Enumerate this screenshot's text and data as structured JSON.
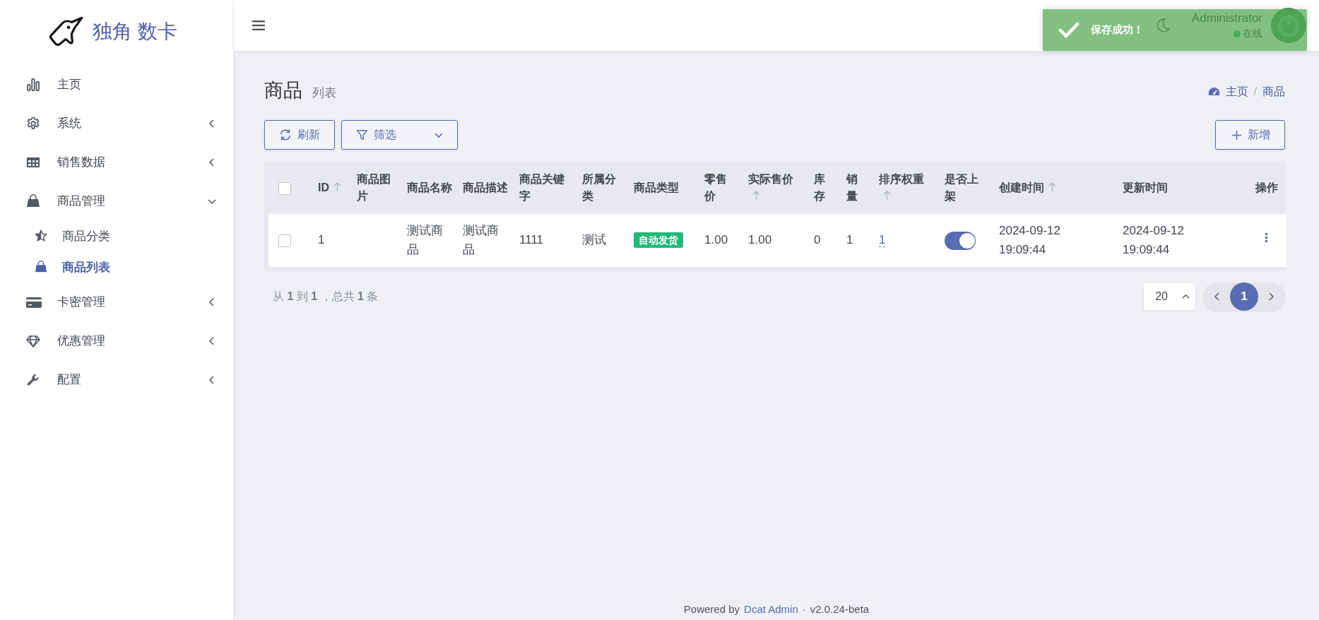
{
  "sidebar": {
    "logo_text": "独角 数卡",
    "items": [
      {
        "label": "主页",
        "kind": "link"
      },
      {
        "label": "系统",
        "kind": "group",
        "expanded": false
      },
      {
        "label": "销售数据",
        "kind": "group",
        "expanded": false
      },
      {
        "label": "商品管理",
        "kind": "group",
        "expanded": true,
        "children": [
          {
            "label": "商品分类",
            "selected": false
          },
          {
            "label": "商品列表",
            "selected": true
          }
        ]
      },
      {
        "label": "卡密管理",
        "kind": "group",
        "expanded": false
      },
      {
        "label": "优惠管理",
        "kind": "group",
        "expanded": false
      },
      {
        "label": "配置",
        "kind": "group",
        "expanded": false
      }
    ]
  },
  "header": {
    "user_name": "Administrator",
    "user_status": "在线"
  },
  "toast": {
    "message": "保存成功！"
  },
  "page": {
    "title": "商品",
    "subtitle": "列表",
    "breadcrumb": {
      "items": [
        "主页",
        "商品"
      ],
      "separator": "/"
    }
  },
  "toolbar": {
    "refresh": "刷新",
    "filter": "筛选",
    "create": "新增"
  },
  "table": {
    "select_all_checked": false,
    "columns": [
      {
        "label": "ID",
        "sortable": true
      },
      {
        "label": "商品图片",
        "sortable": false
      },
      {
        "label": "商品名称",
        "sortable": false
      },
      {
        "label": "商品描述",
        "sortable": false
      },
      {
        "label": "商品关键字",
        "sortable": false
      },
      {
        "label": "所属分类",
        "sortable": false
      },
      {
        "label": "商品类型",
        "sortable": false
      },
      {
        "label": "零售价",
        "sortable": false
      },
      {
        "label": "实际售价",
        "sortable": true
      },
      {
        "label": "库存",
        "sortable": false
      },
      {
        "label": "销量",
        "sortable": false
      },
      {
        "label": "排序权重",
        "sortable": true
      },
      {
        "label": "是否上架",
        "sortable": false
      },
      {
        "label": "创建时间",
        "sortable": true
      },
      {
        "label": "更新时间",
        "sortable": false
      },
      {
        "label": "操作",
        "sortable": false
      }
    ],
    "rows": [
      {
        "checked": false,
        "id": "1",
        "name": "测试商品",
        "description": "测试商品",
        "keyword": "1111",
        "category": "测试",
        "type": "自动发货",
        "retail_price": "1.00",
        "actual_price": "1.00",
        "stock": "0",
        "sales": "1",
        "sort_weight": "1",
        "on_sale": true,
        "created_at": "2024-09-12 19:09:44",
        "updated_at": "2024-09-12 19:09:44"
      }
    ]
  },
  "pagination": {
    "summary": "从 **1** 到 **1** ，总共 **1** 条",
    "per_page": "20",
    "pages": [
      {
        "label": "1",
        "selected": true
      }
    ]
  },
  "footer": {
    "powered": "Powered by",
    "link": "Dcat Admin",
    "dot": "·",
    "version": "v2.0.24-beta"
  }
}
